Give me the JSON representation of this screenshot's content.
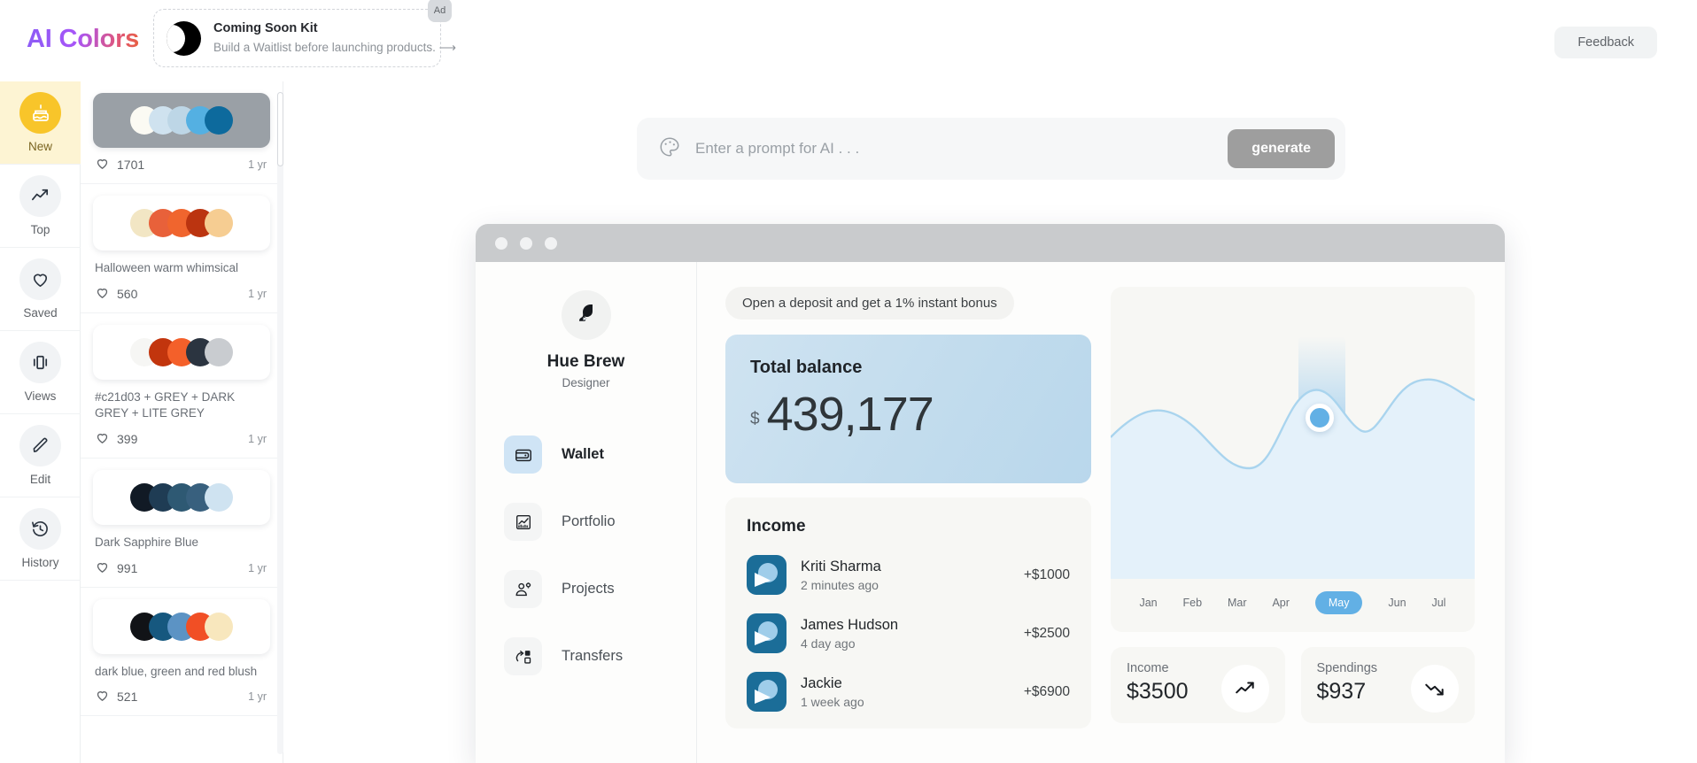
{
  "header": {
    "logo": "AI Colors",
    "feedback_label": "Feedback",
    "ad": {
      "badge": "Ad",
      "title": "Coming Soon Kit",
      "subtitle": "Build a Waitlist before launching products. ⟶"
    }
  },
  "rail": {
    "items": [
      {
        "label": "New",
        "icon": "cake-icon",
        "active": true
      },
      {
        "label": "Top",
        "icon": "trending-up-icon",
        "active": false
      },
      {
        "label": "Saved",
        "icon": "heart-icon",
        "active": false
      },
      {
        "label": "Views",
        "icon": "carousel-icon",
        "active": false
      },
      {
        "label": "Edit",
        "icon": "pencil-icon",
        "active": false
      },
      {
        "label": "History",
        "icon": "history-icon",
        "active": false
      }
    ]
  },
  "palettes": [
    {
      "name": "",
      "likes": "1701",
      "age": "1 yr",
      "box": "grey",
      "colors": [
        "#fbfaf3",
        "#cfe2ef",
        "#bdd6e6",
        "#54b0e2",
        "#0d6a9d"
      ]
    },
    {
      "name": "Halloween warm whimsical",
      "likes": "560",
      "age": "1 yr",
      "box": "white",
      "colors": [
        "#f2e6c4",
        "#e8613a",
        "#f0652e",
        "#bb3410",
        "#f6cd92"
      ]
    },
    {
      "name": "#c21d03 + GREY + DARK GREY + LITE GREY",
      "likes": "399",
      "age": "1 yr",
      "box": "white",
      "colors": [
        "#f6f6f4",
        "#c2350d",
        "#f4602a",
        "#2b3440",
        "#c9ccd0"
      ]
    },
    {
      "name": "Dark Sapphire Blue",
      "likes": "991",
      "age": "1 yr",
      "box": "white",
      "colors": [
        "#111a25",
        "#1f3c54",
        "#2e5973",
        "#38607e",
        "#cfe3f1"
      ]
    },
    {
      "name": "dark blue, green and red blush",
      "likes": "521",
      "age": "1 yr",
      "box": "white",
      "colors": [
        "#111317",
        "#16587f",
        "#5c93c4",
        "#f14f25",
        "#f8e7bd"
      ]
    }
  ],
  "prompt": {
    "placeholder": "Enter a prompt for AI . . .",
    "value": "",
    "generate_label": "generate",
    "icon": "palette-icon"
  },
  "mockup": {
    "profile": {
      "name": "Hue Brew",
      "role": "Designer"
    },
    "nav": [
      {
        "label": "Wallet",
        "icon": "wallet-icon",
        "active": true
      },
      {
        "label": "Portfolio",
        "icon": "chart-icon",
        "active": false
      },
      {
        "label": "Projects",
        "icon": "user-gear-icon",
        "active": false
      },
      {
        "label": "Transfers",
        "icon": "transfer-icon",
        "active": false
      }
    ],
    "deposit_banner": "Open a deposit and get a 1% instant bonus",
    "balance": {
      "label": "Total balance",
      "currency": "$",
      "amount": "439,177"
    },
    "income": {
      "title": "Income",
      "rows": [
        {
          "name": "Kriti Sharma",
          "time": "2 minutes ago",
          "amount": "+$1000"
        },
        {
          "name": "James Hudson",
          "time": "4 day ago",
          "amount": "+$2500"
        },
        {
          "name": "Jackie",
          "time": "1 week ago",
          "amount": "+$6900"
        }
      ]
    },
    "stats": [
      {
        "label": "Income",
        "value": "$3500",
        "icon": "trend-up-icon"
      },
      {
        "label": "Spendings",
        "value": "$937",
        "icon": "trend-down-icon"
      }
    ]
  },
  "chart_data": {
    "type": "area",
    "title": "",
    "categories": [
      "Jan",
      "Feb",
      "Mar",
      "Apr",
      "May",
      "Jun",
      "Jul"
    ],
    "values": [
      52,
      62,
      30,
      33,
      78,
      48,
      72
    ],
    "selected": "May",
    "selected_value": 78,
    "xlabel": "",
    "ylabel": "",
    "ylim": [
      0,
      100
    ],
    "grid": false,
    "legend": "none",
    "line_color": "#a9d4ee",
    "fill_color": "#e2f0fa",
    "marker_color": "#62b0e5"
  }
}
